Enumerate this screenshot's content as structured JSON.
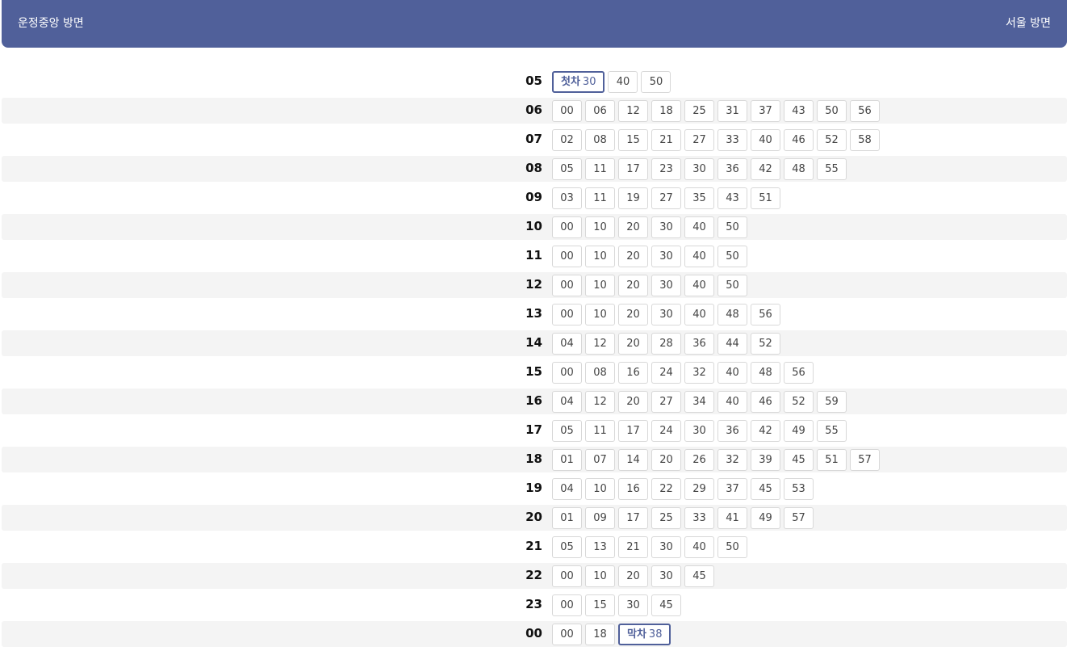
{
  "header": {
    "direction_left": "운정중앙 방면",
    "direction_right": "서울 방면",
    "color": "#50609a"
  },
  "schedule": [
    {
      "hour": "05",
      "minutes": [
        {
          "label": "첫차",
          "value": "30"
        },
        {
          "value": "40"
        },
        {
          "value": "50"
        }
      ]
    },
    {
      "hour": "06",
      "minutes": [
        {
          "value": "00"
        },
        {
          "value": "06"
        },
        {
          "value": "12"
        },
        {
          "value": "18"
        },
        {
          "value": "25"
        },
        {
          "value": "31"
        },
        {
          "value": "37"
        },
        {
          "value": "43"
        },
        {
          "value": "50"
        },
        {
          "value": "56"
        }
      ]
    },
    {
      "hour": "07",
      "minutes": [
        {
          "value": "02"
        },
        {
          "value": "08"
        },
        {
          "value": "15"
        },
        {
          "value": "21"
        },
        {
          "value": "27"
        },
        {
          "value": "33"
        },
        {
          "value": "40"
        },
        {
          "value": "46"
        },
        {
          "value": "52"
        },
        {
          "value": "58"
        }
      ]
    },
    {
      "hour": "08",
      "minutes": [
        {
          "value": "05"
        },
        {
          "value": "11"
        },
        {
          "value": "17"
        },
        {
          "value": "23"
        },
        {
          "value": "30"
        },
        {
          "value": "36"
        },
        {
          "value": "42"
        },
        {
          "value": "48"
        },
        {
          "value": "55"
        }
      ]
    },
    {
      "hour": "09",
      "minutes": [
        {
          "value": "03"
        },
        {
          "value": "11"
        },
        {
          "value": "19"
        },
        {
          "value": "27"
        },
        {
          "value": "35"
        },
        {
          "value": "43"
        },
        {
          "value": "51"
        }
      ]
    },
    {
      "hour": "10",
      "minutes": [
        {
          "value": "00"
        },
        {
          "value": "10"
        },
        {
          "value": "20"
        },
        {
          "value": "30"
        },
        {
          "value": "40"
        },
        {
          "value": "50"
        }
      ]
    },
    {
      "hour": "11",
      "minutes": [
        {
          "value": "00"
        },
        {
          "value": "10"
        },
        {
          "value": "20"
        },
        {
          "value": "30"
        },
        {
          "value": "40"
        },
        {
          "value": "50"
        }
      ]
    },
    {
      "hour": "12",
      "minutes": [
        {
          "value": "00"
        },
        {
          "value": "10"
        },
        {
          "value": "20"
        },
        {
          "value": "30"
        },
        {
          "value": "40"
        },
        {
          "value": "50"
        }
      ]
    },
    {
      "hour": "13",
      "minutes": [
        {
          "value": "00"
        },
        {
          "value": "10"
        },
        {
          "value": "20"
        },
        {
          "value": "30"
        },
        {
          "value": "40"
        },
        {
          "value": "48"
        },
        {
          "value": "56"
        }
      ]
    },
    {
      "hour": "14",
      "minutes": [
        {
          "value": "04"
        },
        {
          "value": "12"
        },
        {
          "value": "20"
        },
        {
          "value": "28"
        },
        {
          "value": "36"
        },
        {
          "value": "44"
        },
        {
          "value": "52"
        }
      ]
    },
    {
      "hour": "15",
      "minutes": [
        {
          "value": "00"
        },
        {
          "value": "08"
        },
        {
          "value": "16"
        },
        {
          "value": "24"
        },
        {
          "value": "32"
        },
        {
          "value": "40"
        },
        {
          "value": "48"
        },
        {
          "value": "56"
        }
      ]
    },
    {
      "hour": "16",
      "minutes": [
        {
          "value": "04"
        },
        {
          "value": "12"
        },
        {
          "value": "20"
        },
        {
          "value": "27"
        },
        {
          "value": "34"
        },
        {
          "value": "40"
        },
        {
          "value": "46"
        },
        {
          "value": "52"
        },
        {
          "value": "59"
        }
      ]
    },
    {
      "hour": "17",
      "minutes": [
        {
          "value": "05"
        },
        {
          "value": "11"
        },
        {
          "value": "17"
        },
        {
          "value": "24"
        },
        {
          "value": "30"
        },
        {
          "value": "36"
        },
        {
          "value": "42"
        },
        {
          "value": "49"
        },
        {
          "value": "55"
        }
      ]
    },
    {
      "hour": "18",
      "minutes": [
        {
          "value": "01"
        },
        {
          "value": "07"
        },
        {
          "value": "14"
        },
        {
          "value": "20"
        },
        {
          "value": "26"
        },
        {
          "value": "32"
        },
        {
          "value": "39"
        },
        {
          "value": "45"
        },
        {
          "value": "51"
        },
        {
          "value": "57"
        }
      ]
    },
    {
      "hour": "19",
      "minutes": [
        {
          "value": "04"
        },
        {
          "value": "10"
        },
        {
          "value": "16"
        },
        {
          "value": "22"
        },
        {
          "value": "29"
        },
        {
          "value": "37"
        },
        {
          "value": "45"
        },
        {
          "value": "53"
        }
      ]
    },
    {
      "hour": "20",
      "minutes": [
        {
          "value": "01"
        },
        {
          "value": "09"
        },
        {
          "value": "17"
        },
        {
          "value": "25"
        },
        {
          "value": "33"
        },
        {
          "value": "41"
        },
        {
          "value": "49"
        },
        {
          "value": "57"
        }
      ]
    },
    {
      "hour": "21",
      "minutes": [
        {
          "value": "05"
        },
        {
          "value": "13"
        },
        {
          "value": "21"
        },
        {
          "value": "30"
        },
        {
          "value": "40"
        },
        {
          "value": "50"
        }
      ]
    },
    {
      "hour": "22",
      "minutes": [
        {
          "value": "00"
        },
        {
          "value": "10"
        },
        {
          "value": "20"
        },
        {
          "value": "30"
        },
        {
          "value": "45"
        }
      ]
    },
    {
      "hour": "23",
      "minutes": [
        {
          "value": "00"
        },
        {
          "value": "15"
        },
        {
          "value": "30"
        },
        {
          "value": "45"
        }
      ]
    },
    {
      "hour": "00",
      "minutes": [
        {
          "value": "00"
        },
        {
          "value": "18"
        },
        {
          "label": "막차",
          "value": "38"
        }
      ]
    }
  ]
}
